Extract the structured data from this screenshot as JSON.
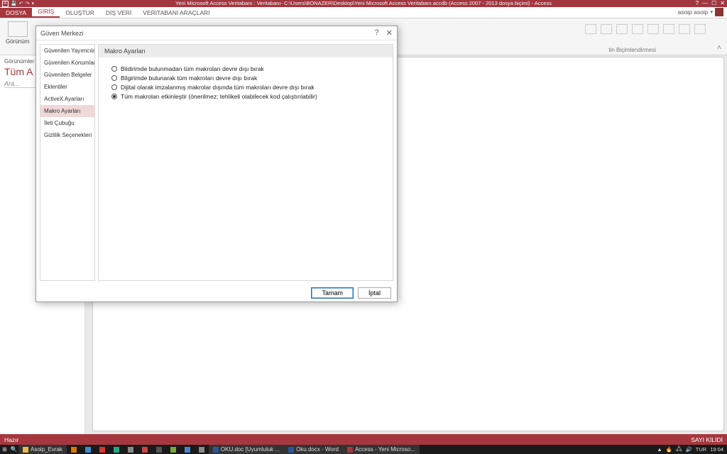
{
  "titlebar": {
    "title": "Yeni Microsoft Access Veritabanı : Veritabanı- C:\\Users\\BONAZER\\Desktop\\Yeni Microsoft Access Veritabanı.accdb (Access 2007 - 2013 dosya biçimi) - Access",
    "min": "—",
    "max": "☐",
    "help": "?",
    "close": "✕"
  },
  "ribbon": {
    "tabs": {
      "file": "DOSYA",
      "home": "GİRİŞ",
      "create": "OLUŞTUR",
      "external": "DIŞ VERİ",
      "dbtools": "VERİTABANI ARAÇLARI"
    },
    "account": "asoip asoip",
    "view_label": "Görünüm",
    "group_label": "tin Biçimlendirmesi",
    "collapse": "˄"
  },
  "leftpane": {
    "header": "Görünümler",
    "title": "Tüm A",
    "search": "Ara..."
  },
  "status": {
    "left": "Hazır",
    "right": "SAYI KİLİDİ"
  },
  "dialog": {
    "title": "Güven Merkezi",
    "help": "?",
    "close": "✕",
    "nav": [
      "Güvenilen Yayımcılar",
      "Güvenilen Konumlar",
      "Güvenilen Belgeler",
      "Eklentiler",
      "ActiveX Ayarları",
      "Makro Ayarları",
      "İleti Çubuğu",
      "Gizlilik Seçenekleri"
    ],
    "nav_selected_index": 5,
    "section_header": "Makro Ayarları",
    "options": [
      "Bildirimde bulunmadan tüm makroları devre dışı bırak",
      "Bilgirimde bulunarak tüm makroları devre dışı bırak",
      "Dijital olarak imzalanmış makrolar dışında tüm makroları devre dışı bırak",
      "Tüm makroları etkinleştir (önerilmez; tehlikeli olabilecek kod çalıştırılabilir)"
    ],
    "selected_option_index": 3,
    "ok": "Tamam",
    "cancel": "İptal"
  },
  "taskbar": {
    "folder": "Asoip_Evrak",
    "apps": {
      "word1": "OKU.doc [Uyumluluk ...",
      "word2": "Oku.docx - Word",
      "access": "Access - Yeni Microso..."
    },
    "lang": "TUR",
    "time": "19:04"
  }
}
